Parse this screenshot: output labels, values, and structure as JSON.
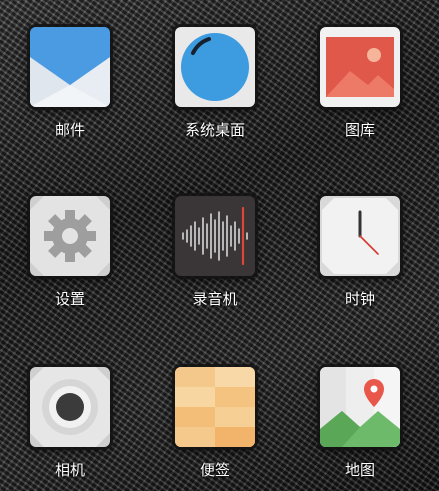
{
  "apps": [
    {
      "label": "邮件",
      "icon": "mail-icon"
    },
    {
      "label": "系统桌面",
      "icon": "system-desktop-icon"
    },
    {
      "label": "图库",
      "icon": "gallery-icon"
    },
    {
      "label": "设置",
      "icon": "settings-gear-icon"
    },
    {
      "label": "录音机",
      "icon": "voice-recorder-waveform-icon"
    },
    {
      "label": "时钟",
      "icon": "clock-icon"
    },
    {
      "label": "相机",
      "icon": "camera-icon"
    },
    {
      "label": "便签",
      "icon": "notes-icon"
    },
    {
      "label": "地图",
      "icon": "map-pin-icon"
    }
  ],
  "colors": {
    "mail_blue": "#3f8fd8",
    "desktop_blue": "#3d9be0",
    "gallery_red": "#e0584a",
    "notes_orange": "#f2b36b",
    "map_green": "#6dbb6a",
    "pin_red": "#e9574b"
  }
}
